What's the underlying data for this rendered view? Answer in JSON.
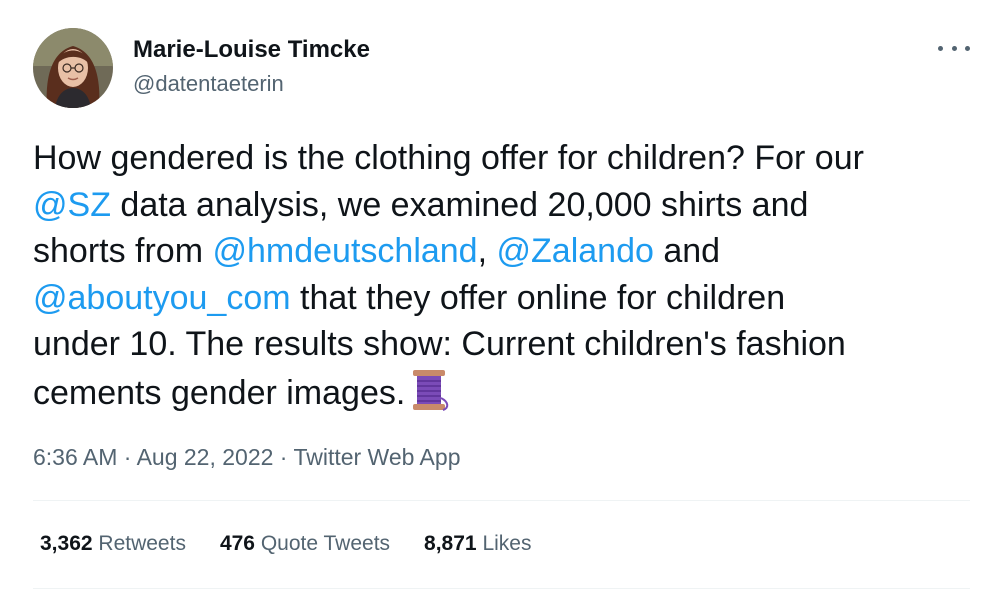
{
  "author": {
    "name": "Marie-Louise Timcke",
    "handle": "@datentaeterin"
  },
  "tweet": {
    "lines": [
      [
        {
          "t": "How gendered is the clothing offer for children? For our"
        }
      ],
      [
        {
          "t": "@SZ",
          "m": true
        },
        {
          "t": " data analysis, we examined 20,000 shirts and"
        }
      ],
      [
        {
          "t": "shorts from "
        },
        {
          "t": "@hmdeutschland",
          "m": true
        },
        {
          "t": ", "
        },
        {
          "t": "@Zalando",
          "m": true
        },
        {
          "t": " and"
        }
      ],
      [
        {
          "t": "@aboutyou_com",
          "m": true
        },
        {
          "t": " that they offer online for children"
        }
      ],
      [
        {
          "t": "under 10. The results show: Current children's fashion"
        }
      ],
      [
        {
          "t": "cements gender images."
        },
        {
          "emoji": "spool-of-thread-icon"
        }
      ]
    ]
  },
  "meta": {
    "time": "6:36 AM",
    "date": "Aug 22, 2022",
    "source": "Twitter Web App",
    "separator": " · "
  },
  "stats": {
    "retweets": {
      "count": "3,362",
      "label": "Retweets"
    },
    "quotes": {
      "count": "476",
      "label": "Quote Tweets"
    },
    "likes": {
      "count": "8,871",
      "label": "Likes"
    }
  },
  "colors": {
    "mention": "#1d9bf0",
    "secondary": "#536471",
    "text": "#0f1419",
    "divider": "#eff3f4"
  }
}
